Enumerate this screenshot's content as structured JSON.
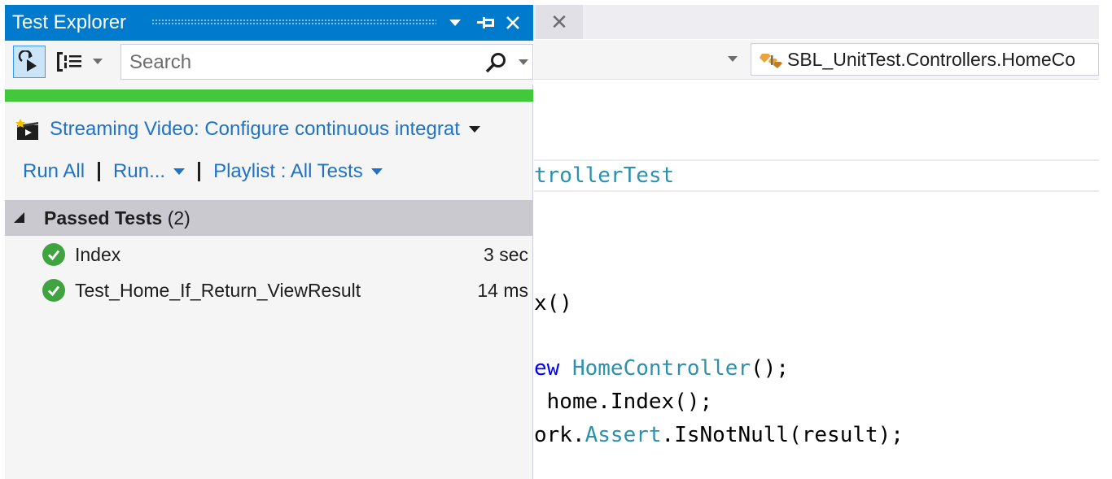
{
  "test_explorer": {
    "title": "Test Explorer",
    "search": {
      "placeholder": "Search",
      "value": ""
    },
    "progress": {
      "fraction": 1.0,
      "color": "#43c83c"
    },
    "promo": {
      "text": "Streaming Video: Configure continuous integrat"
    },
    "actions": {
      "run_all": "Run All",
      "run": "Run...",
      "playlist": "Playlist : All Tests"
    },
    "group": {
      "label": "Passed Tests",
      "count": "(2)"
    },
    "tests": [
      {
        "name": "Index",
        "duration": "3 sec",
        "status": "passed"
      },
      {
        "name": "Test_Home_If_Return_ViewResult",
        "duration": "14 ms",
        "status": "passed"
      }
    ]
  },
  "editor": {
    "tab_close": "✕",
    "class_nav": "SBL_UnitTest.Controllers.HomeCo",
    "code": {
      "sticky_line": "trollerTest",
      "line1": "x()",
      "line2_kw": "ew",
      "line2_type": "HomeController",
      "line2_rest": "();",
      "line3": " home.Index();",
      "line4_a": "ork.",
      "line4_type": "Assert",
      "line4_b": ".IsNotNull(result);"
    }
  },
  "colors": {
    "accent": "#007acc",
    "pass": "#3fa33f",
    "link": "#1e73c8",
    "group_header": "#c9c9cf"
  }
}
